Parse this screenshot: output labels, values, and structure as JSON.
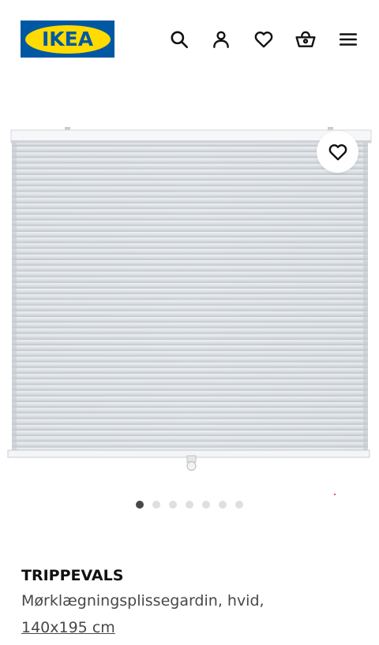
{
  "header": {
    "logo_text": "IKEA",
    "icons": [
      "search-icon",
      "account-icon",
      "heart-icon",
      "basket-icon",
      "menu-icon"
    ]
  },
  "product": {
    "name": "TRIPPEVALS",
    "description": "Mørklægningsplissegardin, hvid,",
    "size": "140x195 cm"
  },
  "carousel": {
    "total_images": 7,
    "active_index": 0
  },
  "colors": {
    "brand_blue": "#0058a3",
    "brand_yellow": "#ffdb00",
    "text_primary": "#111111",
    "text_secondary": "#484848"
  }
}
